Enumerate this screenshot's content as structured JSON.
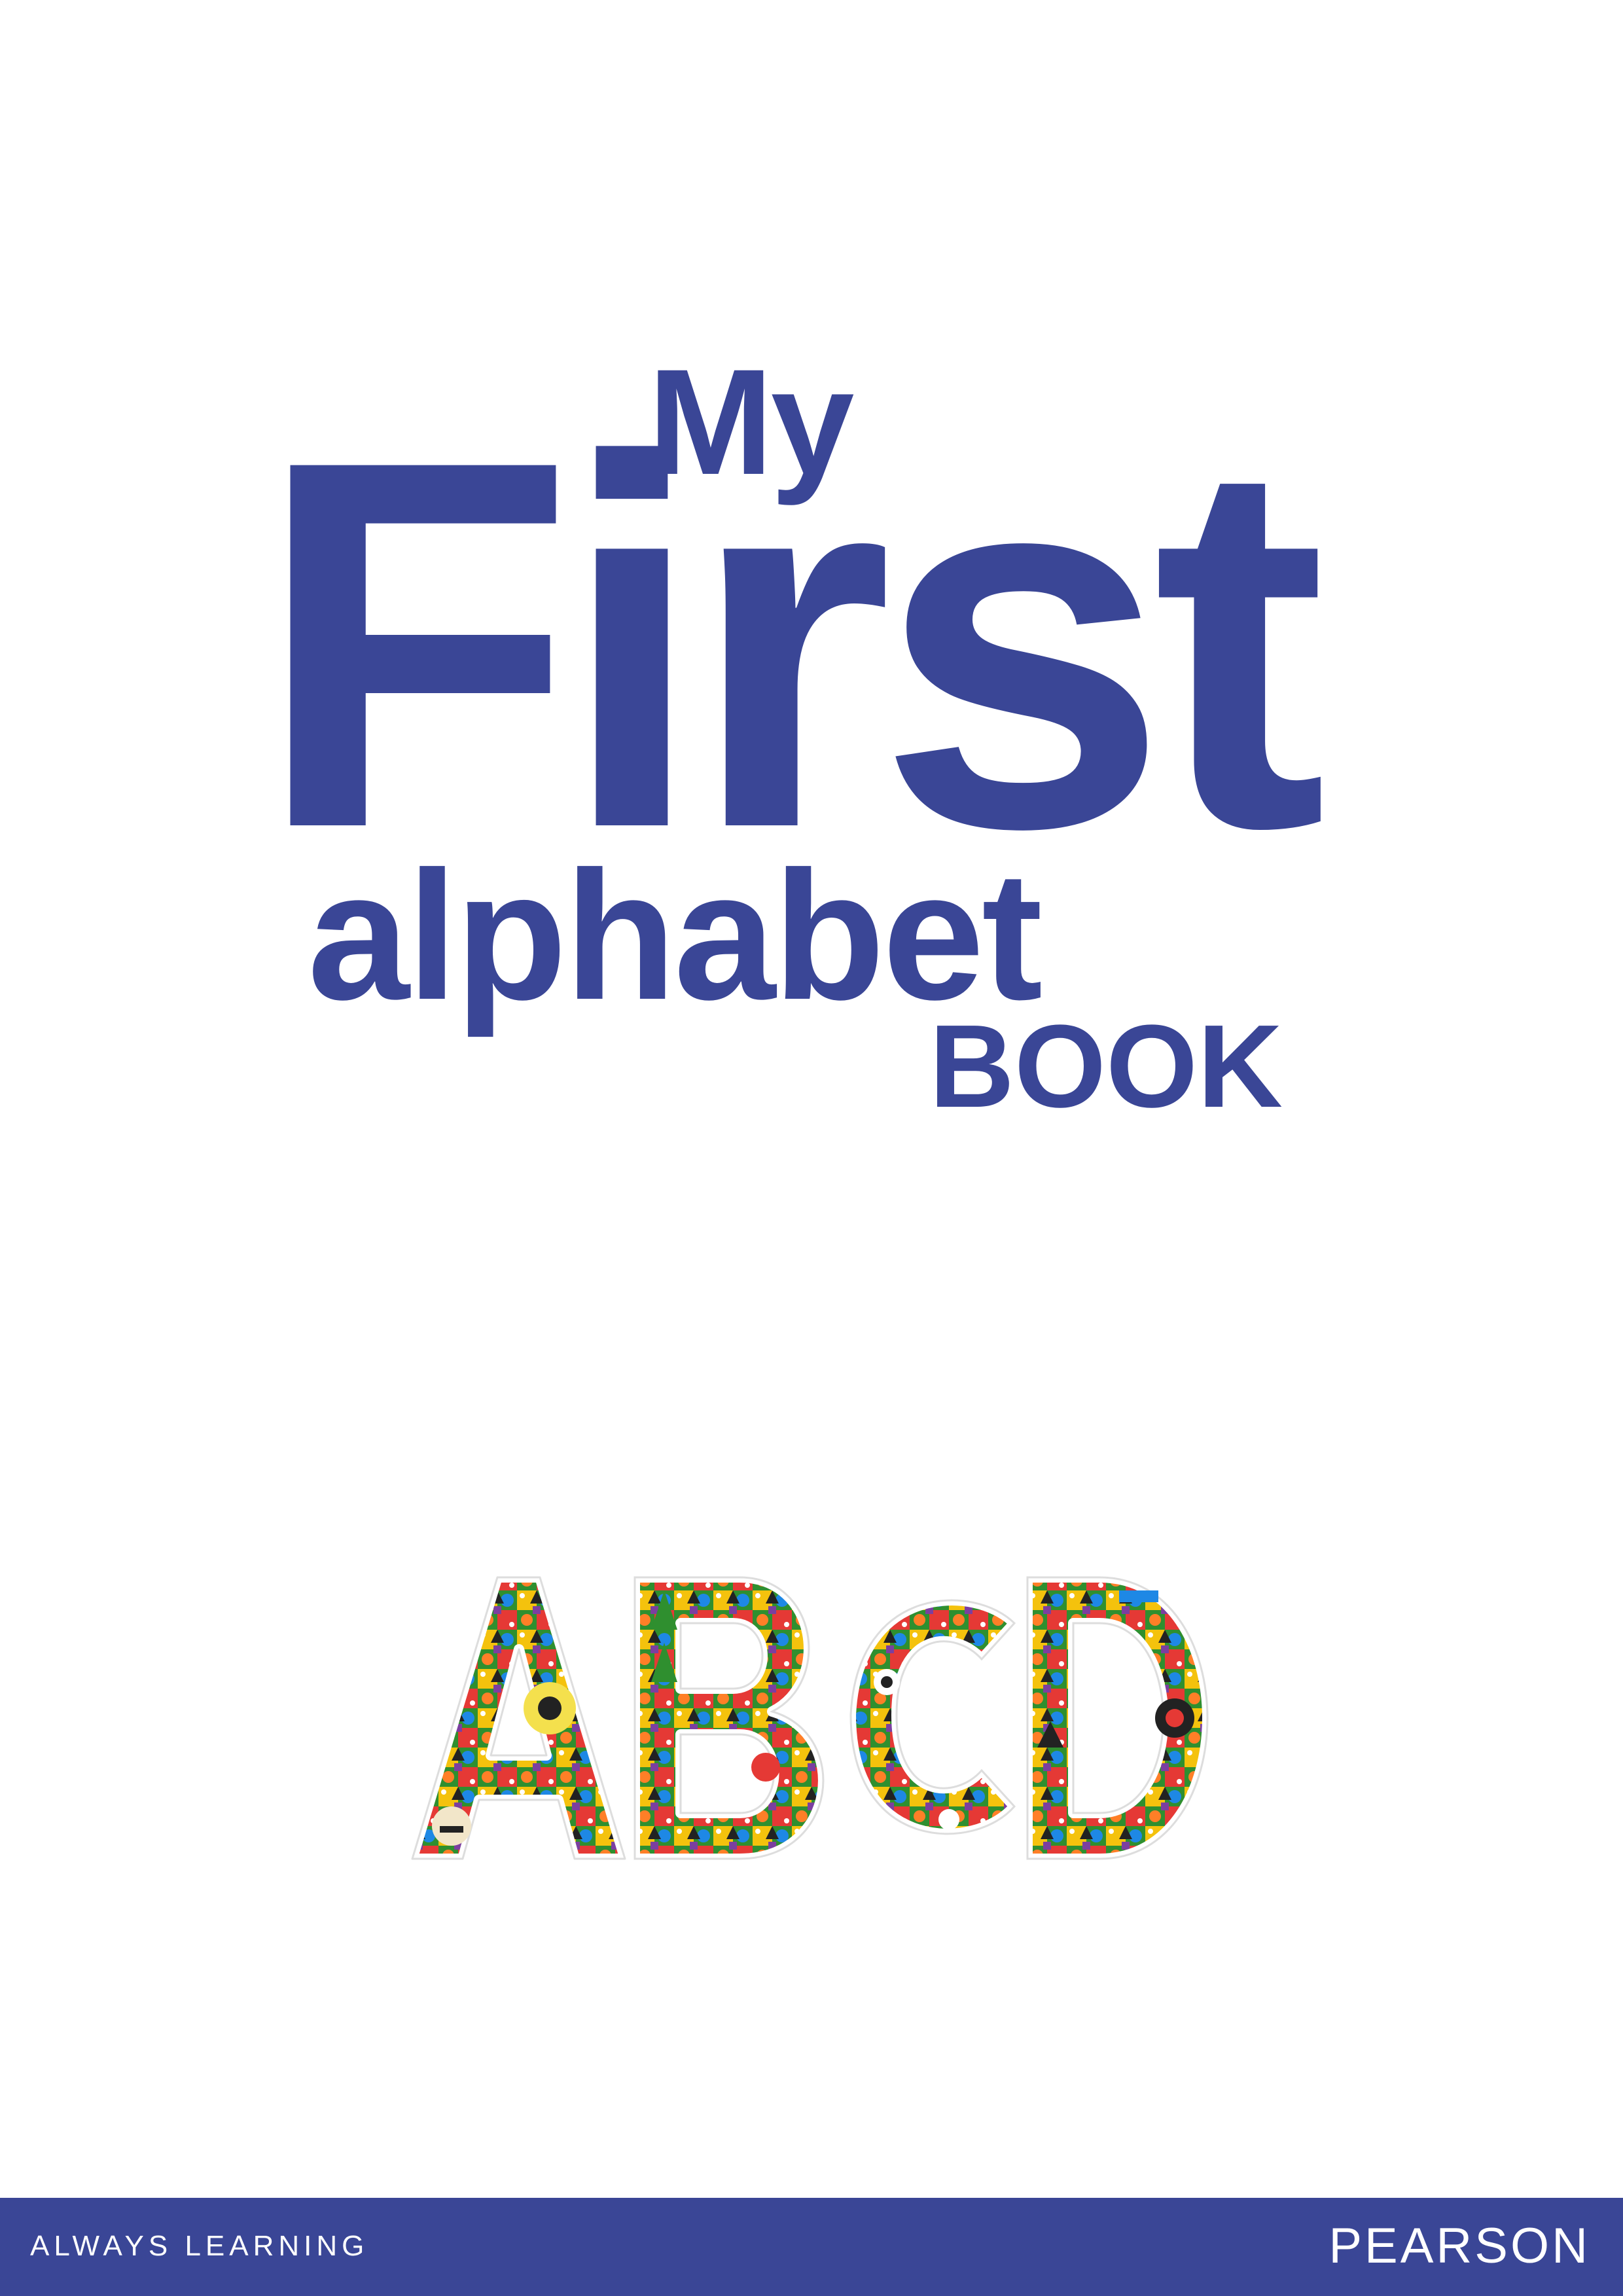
{
  "title": {
    "line1": "My",
    "line2": "First",
    "line3": "alphabet",
    "line4": "BOOK"
  },
  "illustration": {
    "letters": [
      "A",
      "B",
      "C",
      "D"
    ],
    "icon": "illustrated-abcd-letters"
  },
  "footer": {
    "tagline": "ALWAYS LEARNING",
    "brand": "PEARSON"
  },
  "colors": {
    "brand_blue": "#3a4696",
    "background": "#ffffff",
    "footer_text": "#ffffff"
  }
}
